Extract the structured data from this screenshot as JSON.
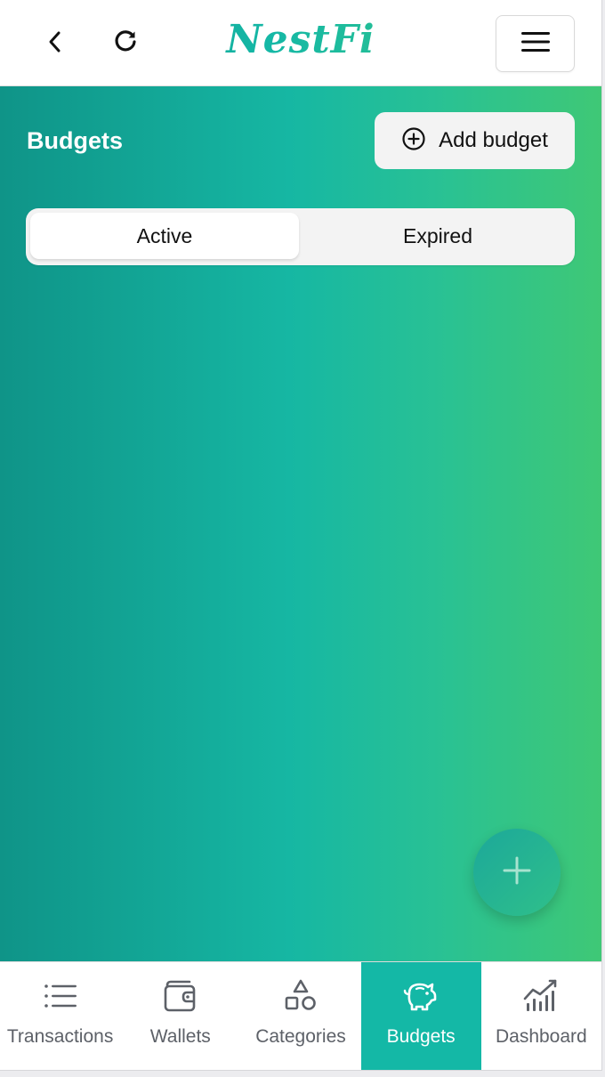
{
  "header": {
    "logo": "NestFi",
    "back_icon": "chevron-left-icon",
    "reload_icon": "reload-icon",
    "menu_icon": "hamburger-menu-icon"
  },
  "page": {
    "title": "Budgets",
    "add_button": {
      "label": "Add budget",
      "icon": "plus-circle-icon"
    },
    "tabs": [
      {
        "label": "Active",
        "selected": true
      },
      {
        "label": "Expired",
        "selected": false
      }
    ],
    "fab_icon": "plus-icon"
  },
  "nav": {
    "items": [
      {
        "label": "Transactions",
        "icon": "list-icon",
        "active": false
      },
      {
        "label": "Wallets",
        "icon": "wallet-icon",
        "active": false
      },
      {
        "label": "Categories",
        "icon": "shapes-icon",
        "active": false
      },
      {
        "label": "Budgets",
        "icon": "piggy-bank-icon",
        "active": true
      },
      {
        "label": "Dashboard",
        "icon": "chart-icon",
        "active": false
      }
    ]
  },
  "colors": {
    "brand_start": "#0f9488",
    "brand_mid": "#15b8a6",
    "brand_end": "#3ec97a",
    "active_nav": "#14b8a6"
  }
}
